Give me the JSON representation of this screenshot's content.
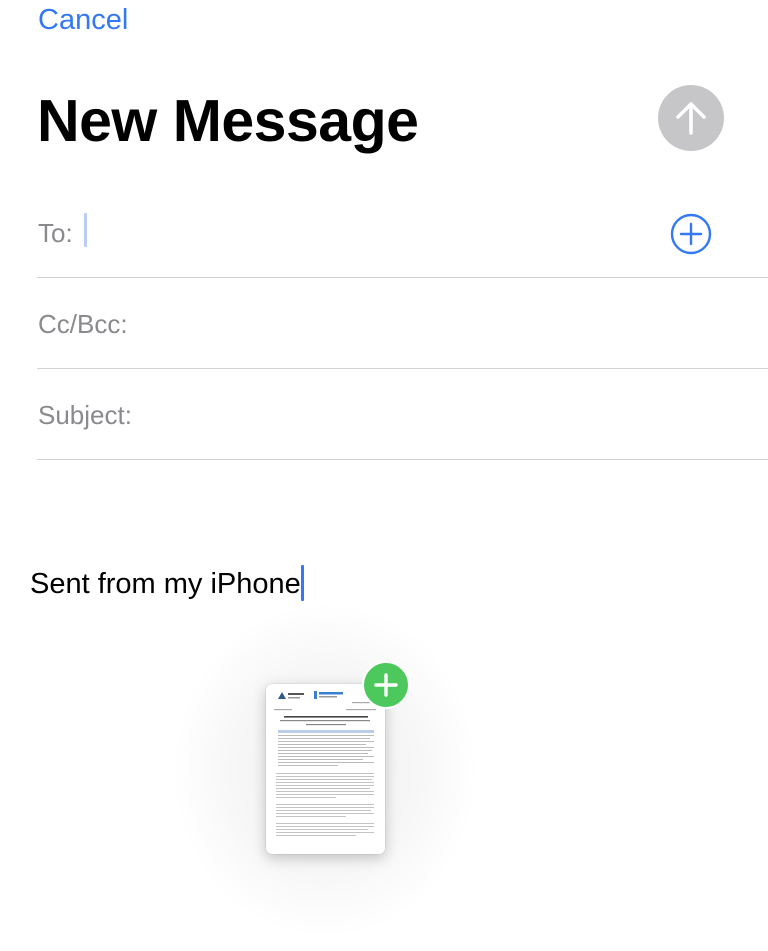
{
  "header": {
    "cancel_label": "Cancel",
    "title": "New Message"
  },
  "fields": {
    "to_label": "To:",
    "cc_bcc_label": "Cc/Bcc:",
    "subject_label": "Subject:"
  },
  "body": {
    "signature": "Sent from my iPhone"
  },
  "icons": {
    "send": "arrow-up-icon",
    "add_contact": "plus-circle-icon",
    "drop_add": "plus-icon",
    "attachment": "document-thumbnail"
  },
  "colors": {
    "accent": "#3478f6",
    "send_disabled": "#c6c6c8",
    "drop_badge": "#4cc85c",
    "label_gray": "#8a8a8e",
    "separator": "#d1d1d6"
  }
}
